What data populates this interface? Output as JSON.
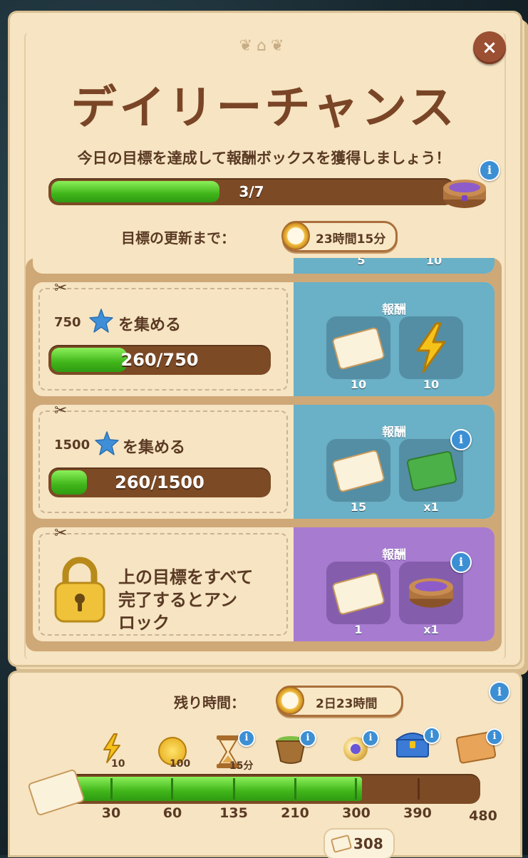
{
  "header": {
    "title": "デイリーチャンス",
    "subtitle": "今日の目標を達成して報酬ボックスを獲得しましょう！",
    "close_icon": "×"
  },
  "overall_progress": {
    "text": "3/7",
    "current": 3,
    "total": 7
  },
  "refresh": {
    "label": "目標の更新まで：",
    "time": "23時間15分"
  },
  "top_partial": {
    "left_qty": "5",
    "right_qty": "10"
  },
  "tasks": [
    {
      "amount": "750",
      "suffix": "を集める",
      "progress_text": "260/750",
      "progress": 0.347,
      "reward_title": "報酬",
      "rewards": [
        {
          "icon": "ticket-icon",
          "qty": "10"
        },
        {
          "icon": "lightning-icon",
          "qty": "10"
        }
      ]
    },
    {
      "amount": "1500",
      "suffix": "を集める",
      "progress_text": "260/1500",
      "progress": 0.173,
      "reward_title": "報酬",
      "rewards": [
        {
          "icon": "ticket-icon",
          "qty": "15"
        },
        {
          "icon": "green-card-icon",
          "qty": "x1"
        }
      ]
    },
    {
      "locked_text_1": "上の目標をすべて",
      "locked_text_2": "完了するとアン",
      "locked_text_3": "ロック",
      "reward_title": "報酬",
      "rewards": [
        {
          "icon": "ticket-icon",
          "qty": "1"
        },
        {
          "icon": "reward-box-icon",
          "qty": "x1"
        }
      ]
    }
  ],
  "season": {
    "remaining_label": "残り時間：",
    "remaining_time": "2日23時間",
    "prizes": [
      {
        "icon": "lightning-icon",
        "label": "10"
      },
      {
        "icon": "coin-icon",
        "label": "100"
      },
      {
        "icon": "hourglass-icon",
        "label": "15分"
      },
      {
        "icon": "basket-icon",
        "label": ""
      },
      {
        "icon": "potion-icon",
        "label": ""
      },
      {
        "icon": "chest-icon",
        "label": ""
      },
      {
        "icon": "card-icon",
        "label": ""
      }
    ],
    "milestones": [
      "30",
      "60",
      "135",
      "210",
      "300",
      "390",
      "480"
    ],
    "current_points": "308",
    "progress": 308
  },
  "colors": {
    "panel": "#f6e4c2",
    "title_brown": "#7a4527",
    "bar_brown": "#7c4a25",
    "green": "#40b51a",
    "reward_blue": "#6ab0c6",
    "reward_purple": "#a77bd0",
    "info_blue": "#3d8fd4"
  }
}
